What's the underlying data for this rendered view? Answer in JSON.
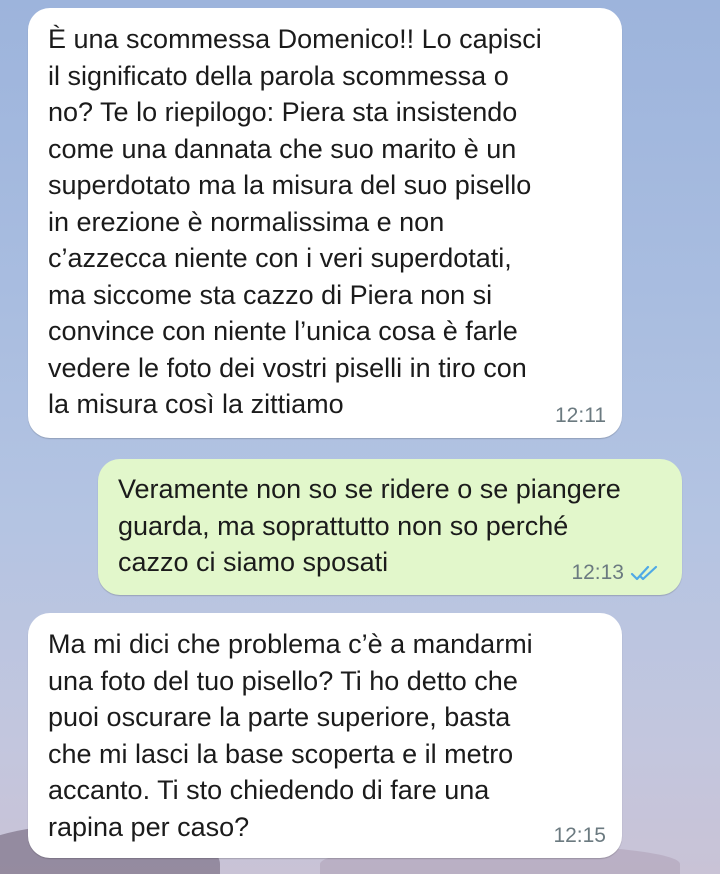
{
  "conversation": {
    "messages": [
      {
        "direction": "incoming",
        "text": "È una scommessa Domenico!! Lo capisci\nil significato della parola scommessa o\nno? Te lo riepilogo: Piera sta insistendo\ncome una dannata che suo marito è un\nsuperdotato ma la misura del suo pisello\nin erezione è normalissima e non\nc’azzecca niente con i veri superdotati,\nma siccome sta cazzo di Piera non si\nconvince con niente l’unica cosa è farle\nvedere le foto dei vostri piselli in tiro con\nla misura così la zittiamo",
        "time": "12:11"
      },
      {
        "direction": "outgoing",
        "text": "Veramente non so se ridere o se piangere\nguarda, ma soprattutto non so perché\ncazzo ci siamo sposati",
        "time": "12:13",
        "status_icon": "double-check-icon",
        "status_color": "#4fa9e6"
      },
      {
        "direction": "incoming",
        "text": "Ma mi dici che problema c’è a mandarmi\nuna foto del tuo pisello? Ti ho detto che\npuoi oscurare la parte superiore, basta\nche mi lasci la base scoperta e il metro\naccanto. Ti sto chiedendo di fare una\nrapina per caso?",
        "time": "12:15"
      }
    ]
  },
  "colors": {
    "incoming_bubble": "#ffffff",
    "outgoing_bubble": "#e2f7cb",
    "read_ticks": "#4fa9e6",
    "timestamp": "#6b7a80"
  }
}
